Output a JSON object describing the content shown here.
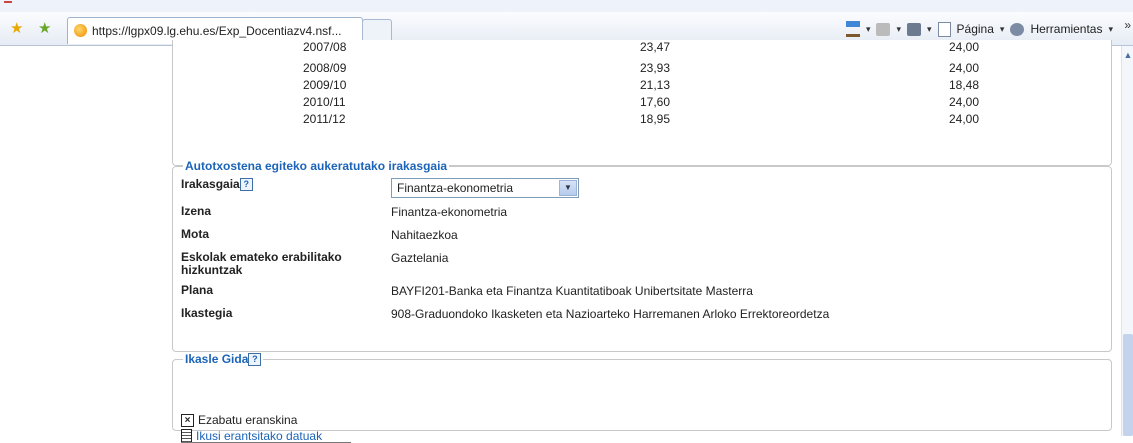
{
  "browser": {
    "tab_url": "https://lgpx09.lg.ehu.es/Exp_Docentiazv4.nsf...",
    "toolbar": {
      "page_label": "Página",
      "tools_label": "Herramientas",
      "dropdown_glyph": "▾",
      "more_glyph": "»"
    }
  },
  "years_table": {
    "rows": [
      {
        "year": "2007/08",
        "v1": "23,47",
        "v2": "24,00"
      },
      {
        "year": "2008/09",
        "v1": "23,93",
        "v2": "24,00"
      },
      {
        "year": "2009/10",
        "v1": "21,13",
        "v2": "18,48"
      },
      {
        "year": "2010/11",
        "v1": "17,60",
        "v2": "24,00"
      },
      {
        "year": "2011/12",
        "v1": "18,95",
        "v2": "24,00"
      }
    ]
  },
  "subject_section": {
    "title": "Autotxostena egiteko aukeratutako irakasgaia",
    "selector": {
      "label": "Irakasgaia",
      "help": "?",
      "value": "Finantza-ekonometria"
    },
    "fields": [
      {
        "label": "Izena",
        "value": "Finantza-ekonometria"
      },
      {
        "label": "Mota",
        "value": "Nahitaezkoa"
      },
      {
        "label": "Eskolak emateko erabilitako hizkuntzak",
        "value": "Gaztelania"
      },
      {
        "label": "Plana",
        "value": "BAYFI201-Banka eta Finantza Kuantitatiboak Unibertsitate Masterra"
      },
      {
        "label": "Ikastegia",
        "value": "908-Graduondoko Ikasketen eta Nazioarteko Harremanen Arloko Errektoreordetza"
      }
    ]
  },
  "guide_section": {
    "title": "Ikasle Gida",
    "help": "?",
    "delete_label": "Ezabatu eranskina",
    "view_link": "Ikusi erantsitako datuak"
  }
}
